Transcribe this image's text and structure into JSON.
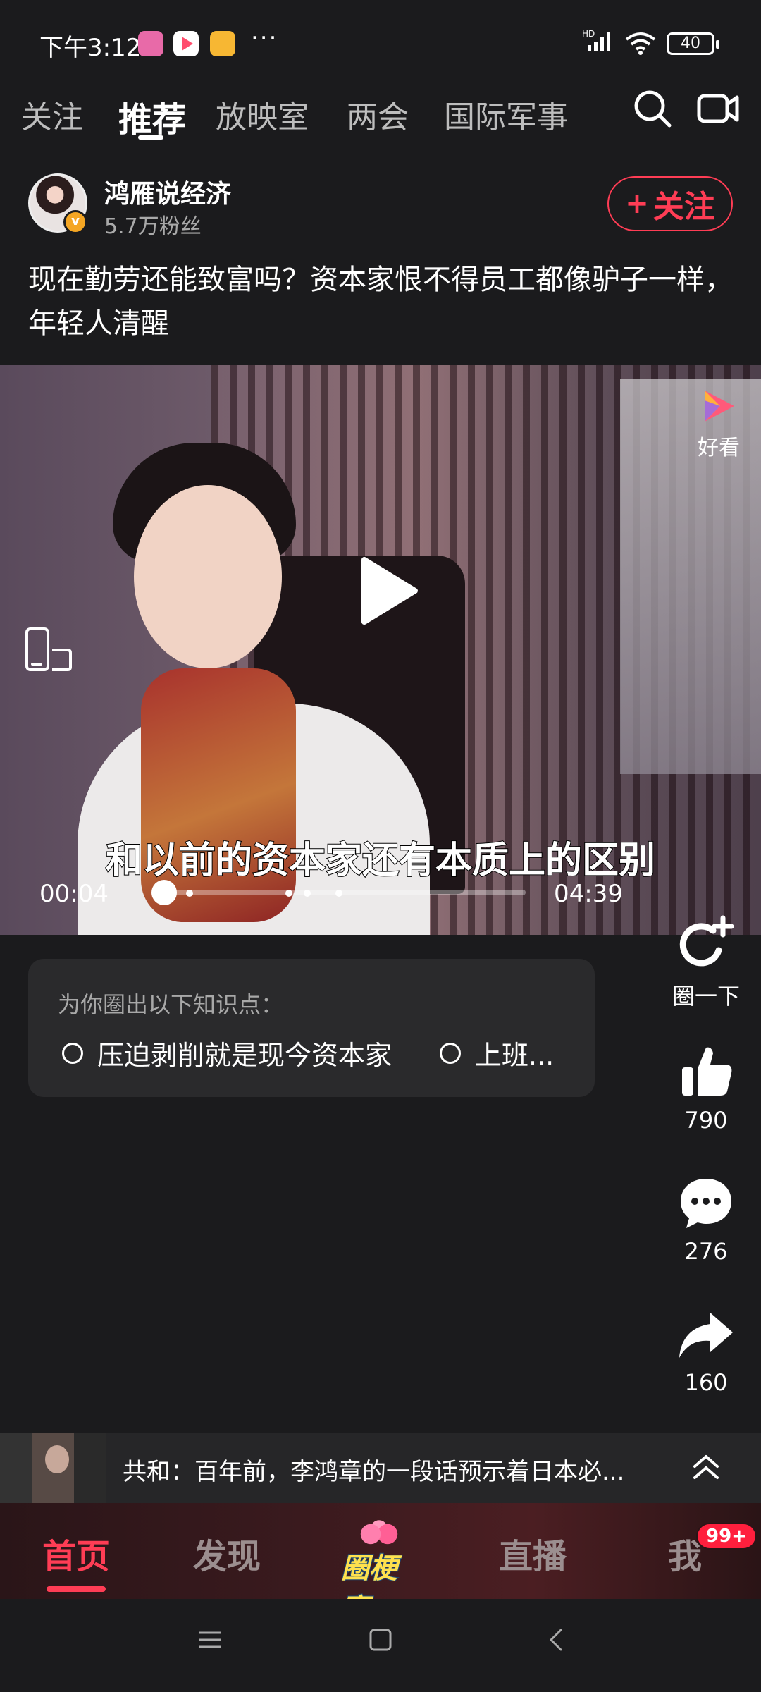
{
  "status_bar": {
    "time": "下午3:12",
    "more": "···",
    "network": "HD",
    "battery": "40"
  },
  "top_tabs": [
    {
      "label": "关注",
      "active": false
    },
    {
      "label": "推荐",
      "active": true
    },
    {
      "label": "放映室",
      "active": false
    },
    {
      "label": "两会",
      "active": false
    },
    {
      "label": "国际军事",
      "active": false
    }
  ],
  "top_icons": [
    "search-icon",
    "video-camera-icon"
  ],
  "author": {
    "name": "鸿雁说经济",
    "fans": "5.7万粉丝",
    "follow_plus": "+",
    "follow_label": "关注",
    "verified_mark": "v"
  },
  "post": {
    "title": "现在勤劳还能致富吗？资本家恨不得员工都像驴子一样，年轻人清醒"
  },
  "video": {
    "subtitle": "和以前的资本家还有本质上的区别",
    "current_time": "00:04",
    "total_time": "04:39",
    "progress": 0.014,
    "brand_label": "好看"
  },
  "knowledge": {
    "header": "为你圈出以下知识点：",
    "points": [
      "压迫剥削就是现今资本家",
      "上班..."
    ]
  },
  "actions": [
    {
      "icon": "circle-refresh-icon",
      "label": "圈一下"
    },
    {
      "icon": "thumbs-up-icon",
      "label": "790"
    },
    {
      "icon": "comment-icon",
      "label": "276"
    },
    {
      "icon": "share-icon",
      "label": "160"
    }
  ],
  "related": {
    "text": "共和：百年前，李鸿章的一段话预示着日本必..."
  },
  "bottom_nav": {
    "items": [
      {
        "label": "首页",
        "active": true
      },
      {
        "label": "发现",
        "active": false
      },
      {
        "label": "直播",
        "active": false
      },
      {
        "label": "我",
        "active": false
      }
    ],
    "center_label": "圈梗赛",
    "badge": "99+"
  },
  "colors": {
    "accent": "#ff3d55",
    "background": "#1b1b1d"
  }
}
